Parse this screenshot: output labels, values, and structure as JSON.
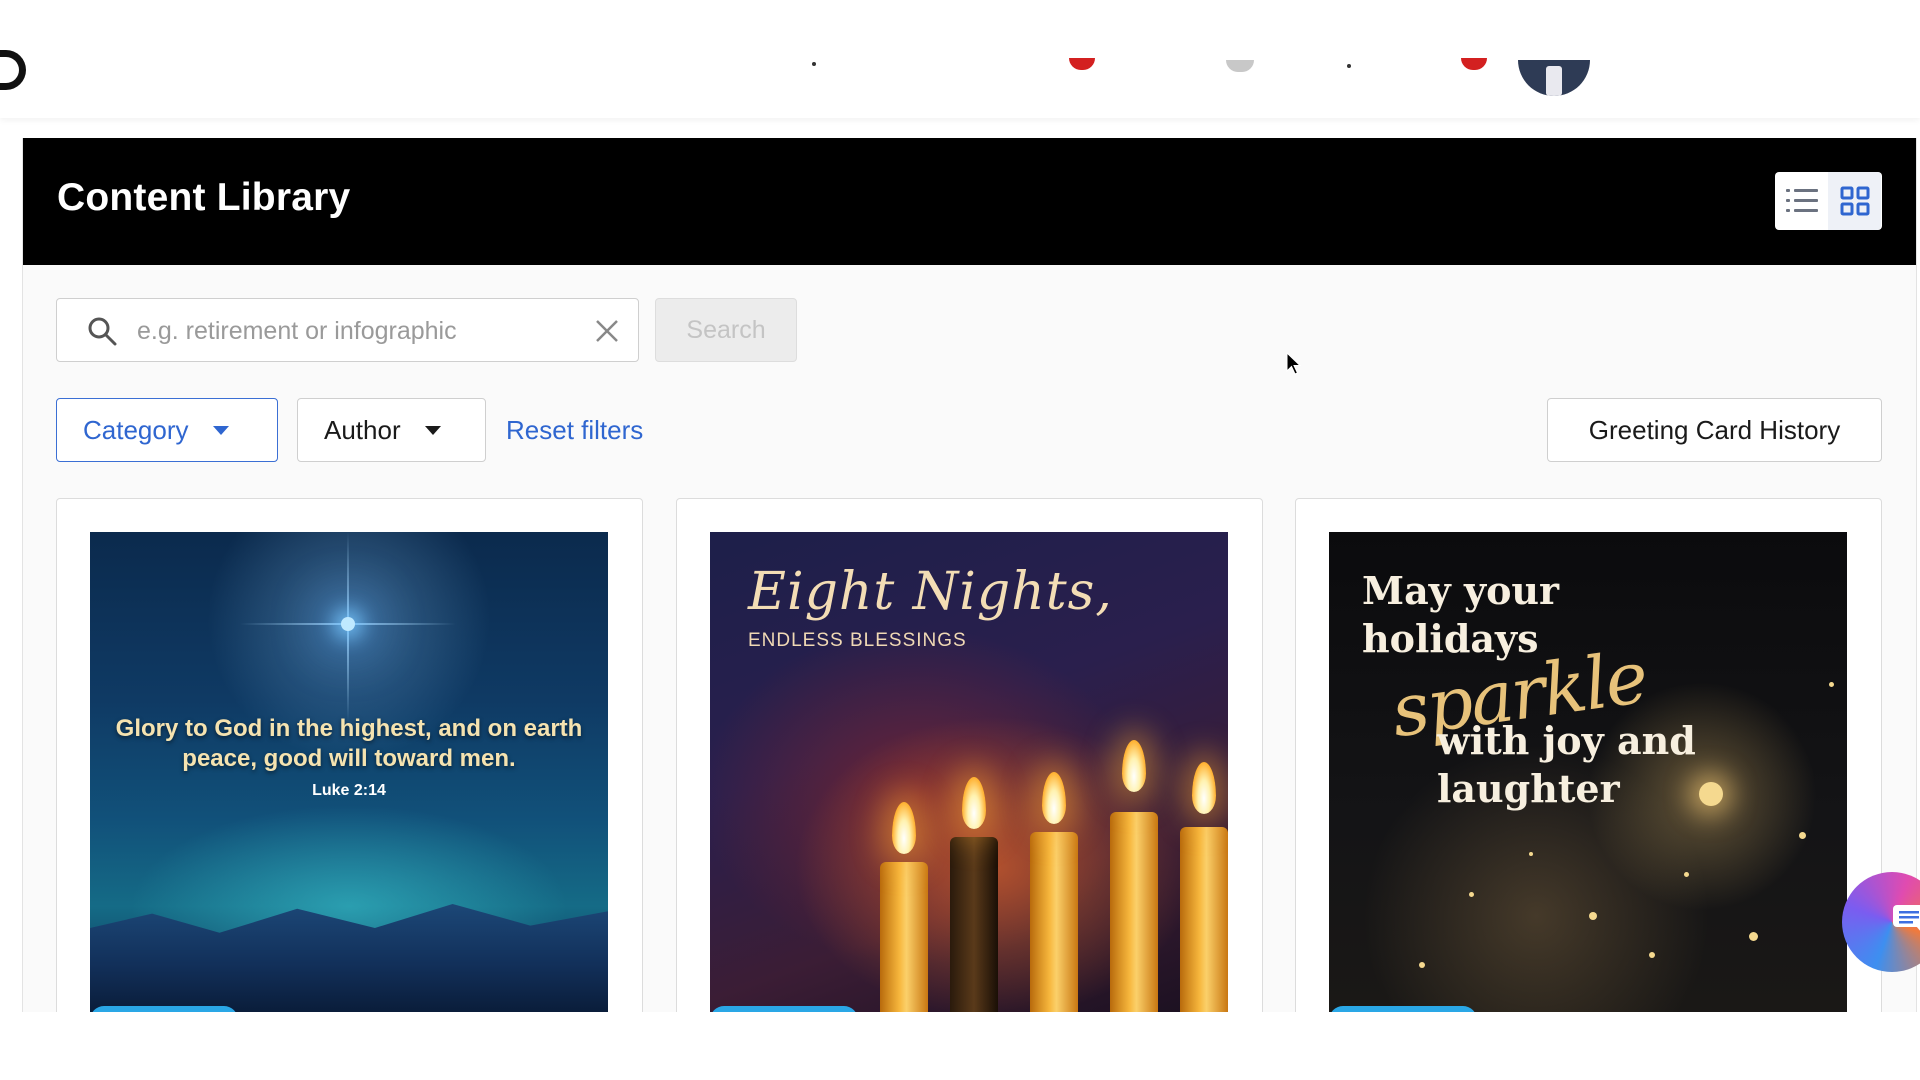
{
  "header": {
    "title": "Content Library",
    "view_list_icon": "list-icon",
    "view_grid_icon": "grid-icon"
  },
  "search": {
    "placeholder": "e.g. retirement or infographic",
    "value": "",
    "button_label": "Search"
  },
  "filters": {
    "category_label": "Category",
    "author_label": "Author",
    "reset_label": "Reset filters"
  },
  "history_button_label": "Greeting Card History",
  "cards": [
    {
      "verse": "Glory to God in the highest, and on earth peace, good will toward men.",
      "reference": "Luke 2:14"
    },
    {
      "title": "Eight Nights,",
      "subtitle": "ENDLESS BLESSINGS"
    },
    {
      "line1": "May your",
      "line2": "holidays",
      "script": "sparkle",
      "line3": "with joy and",
      "line4": "laughter"
    }
  ],
  "colors": {
    "accent_blue": "#2f66d0",
    "header_bg": "#000000",
    "tag_blue": "#2aa7e6"
  }
}
